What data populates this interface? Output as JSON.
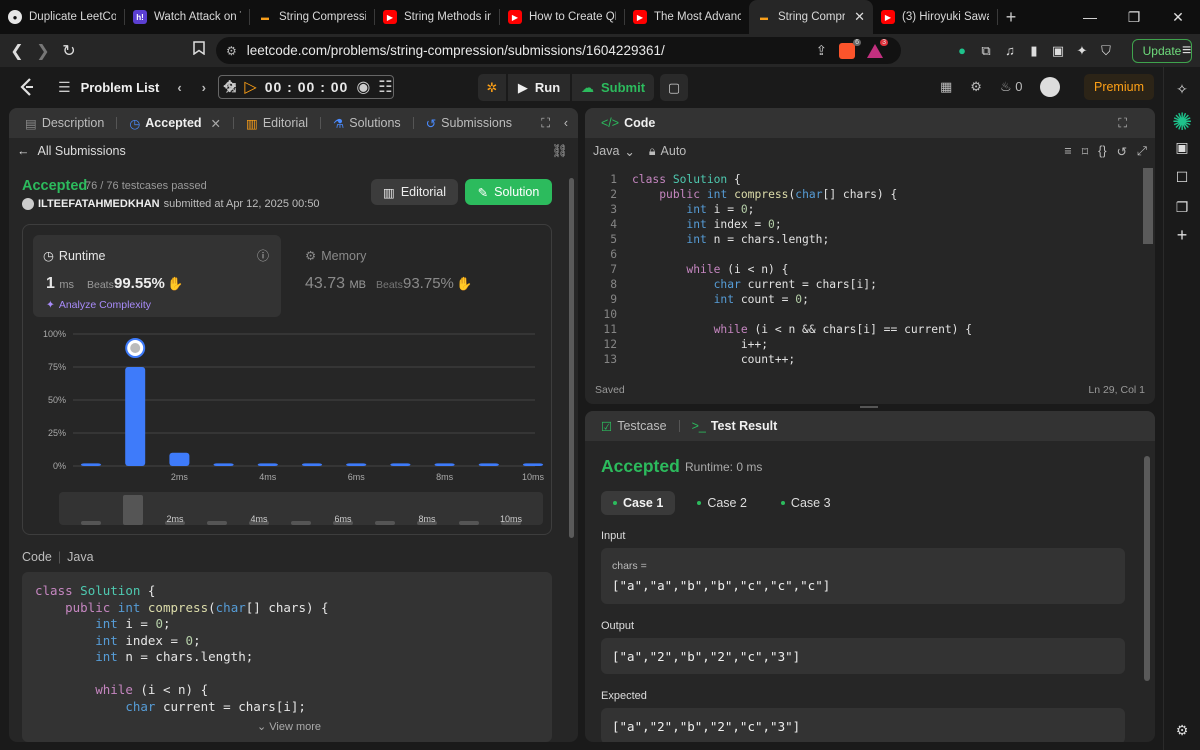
{
  "browser": {
    "tabs": [
      {
        "title": "Duplicate LeetCode",
        "icon": "github-icon",
        "color": "#e6e6e6"
      },
      {
        "title": "Watch Attack on Ti",
        "icon": "hianime-icon",
        "color": "#5b3fd1"
      },
      {
        "title": "String Compression",
        "icon": "leetcode-icon",
        "color": "#f89f1b"
      },
      {
        "title": "String Methods in",
        "icon": "youtube-icon",
        "color": "#ff0000"
      },
      {
        "title": "How to Create QR",
        "icon": "youtube-icon",
        "color": "#ff0000"
      },
      {
        "title": "The Most Advance",
        "icon": "youtube-icon",
        "color": "#ff0000"
      },
      {
        "title": "String Compre",
        "icon": "leetcode-icon",
        "color": "#f89f1b"
      },
      {
        "title": "(3) Hiroyuki Sawan",
        "icon": "youtube-icon",
        "color": "#ff0000"
      }
    ],
    "url": "leetcode.com/problems/string-compression/submissions/1604229361/",
    "brave_badge": "6",
    "ext_badge": "3",
    "update_label": "Update"
  },
  "nav": {
    "problem_list": "Problem List",
    "timer": "00 : 00 : 00",
    "run": "Run",
    "submit": "Submit",
    "streak": "0",
    "premium": "Premium"
  },
  "left": {
    "tabs": [
      "Description",
      "Accepted",
      "Editorial",
      "Solutions",
      "Submissions"
    ],
    "all_submissions": "All Submissions",
    "status": "Accepted",
    "testcases": "76 / 76 testcases passed",
    "user": "ILTEEFATAHMEDKHAN",
    "submitted_at": "submitted at Apr 12, 2025 00:50",
    "editorial_btn": "Editorial",
    "solution_btn": "Solution",
    "runtime": {
      "label": "Runtime",
      "value": "1",
      "unit": "ms",
      "beats_label": "Beats",
      "beats": "99.55%",
      "analyze": "Analyze Complexity"
    },
    "memory": {
      "label": "Memory",
      "value": "43.73",
      "unit": "MB",
      "beats_label": "Beats",
      "beats": "93.75%"
    },
    "code_label": "Code",
    "code_lang": "Java",
    "code_lines": [
      "class Solution {",
      "    public int compress(char[] chars) {",
      "        int i = 0;",
      "        int index = 0;",
      "        int n = chars.length;",
      "",
      "        while (i < n) {",
      "            char current = chars[i];"
    ],
    "view_more": "View more"
  },
  "chart_data": {
    "type": "bar",
    "title": "",
    "xlabel": "",
    "ylabel": "",
    "y_ticks": [
      "100%",
      "75%",
      "50%",
      "25%",
      "0%"
    ],
    "x_ticks": [
      "2ms",
      "4ms",
      "6ms",
      "8ms",
      "10ms"
    ],
    "ylim": [
      0,
      100
    ],
    "categories": [
      "0ms",
      "1ms",
      "2ms",
      "3ms",
      "4ms",
      "5ms",
      "6ms",
      "7ms",
      "8ms",
      "9ms",
      "10ms"
    ],
    "values": [
      2,
      75,
      10,
      2,
      2,
      2,
      2,
      2,
      2,
      2,
      2
    ],
    "highlight_index": 1,
    "colors": {
      "bar": "#3e7bfa",
      "grid": "#444444"
    },
    "grid": true
  },
  "code_panel": {
    "title": "Code",
    "language": "Java",
    "mode": "Auto",
    "status": "Saved",
    "cursor": "Ln 29, Col 1",
    "lines": [
      "class Solution {",
      "    public int compress(char[] chars) {",
      "        int i = 0;",
      "        int index = 0;",
      "        int n = chars.length;",
      "",
      "        while (i < n) {",
      "            char current = chars[i];",
      "            int count = 0;",
      "",
      "            while (i < n && chars[i] == current) {",
      "                i++;",
      "                count++;"
    ]
  },
  "result": {
    "tabs": [
      "Testcase",
      "Test Result"
    ],
    "status": "Accepted",
    "runtime": "Runtime: 0 ms",
    "cases": [
      "Case 1",
      "Case 2",
      "Case 3"
    ],
    "input_label": "Input",
    "input_key": "chars =",
    "input_value": "[\"a\",\"a\",\"b\",\"b\",\"c\",\"c\",\"c\"]",
    "output_label": "Output",
    "output_value": "[\"a\",\"2\",\"b\",\"2\",\"c\",\"3\"]",
    "expected_label": "Expected",
    "expected_value": "[\"a\",\"2\",\"b\",\"2\",\"c\",\"3\"]"
  }
}
